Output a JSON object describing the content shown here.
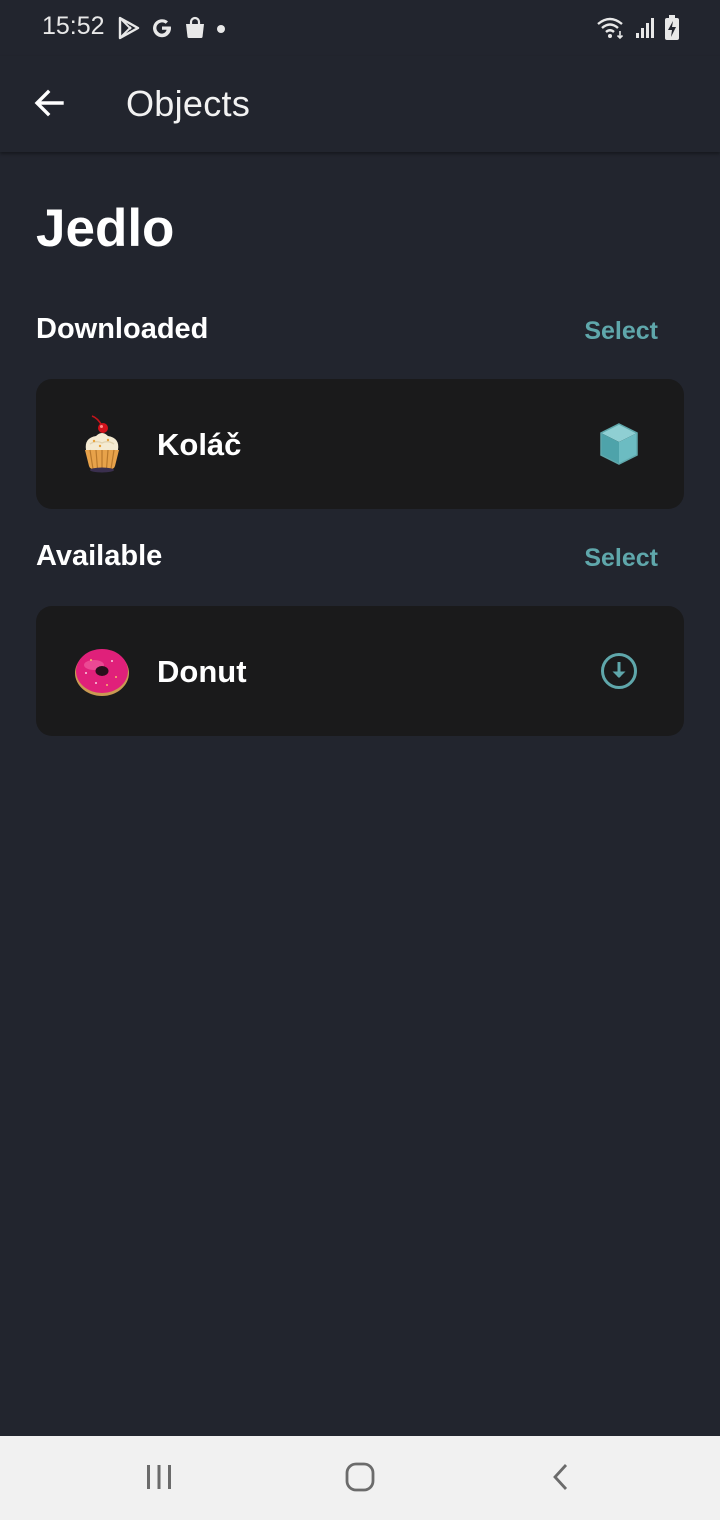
{
  "status_bar": {
    "time": "15:52",
    "left_icons": [
      "play-store-icon",
      "google-icon",
      "shopping-bag-icon",
      "dot-icon"
    ],
    "right_icons": [
      "wifi-icon",
      "signal-icon",
      "battery-charging-icon"
    ]
  },
  "app_bar": {
    "back_icon": "arrow-left-icon",
    "title": "Objects"
  },
  "page": {
    "heading": "Jedlo"
  },
  "sections": {
    "downloaded": {
      "title": "Downloaded",
      "select_label": "Select",
      "items": [
        {
          "label": "Koláč",
          "thumbnail": "cupcake-icon",
          "action_icon": "cube-icon"
        }
      ]
    },
    "available": {
      "title": "Available",
      "select_label": "Select",
      "items": [
        {
          "label": "Donut",
          "thumbnail": "donut-icon",
          "action_icon": "download-circle-icon"
        }
      ]
    }
  },
  "colors": {
    "background": "#22252e",
    "card": "#1a1a1b",
    "accent": "#5fa7ab",
    "nav_bar": "#f1f1f1"
  },
  "nav_bar": {
    "buttons": [
      "recent-apps-icon",
      "home-icon",
      "back-nav-icon"
    ]
  }
}
